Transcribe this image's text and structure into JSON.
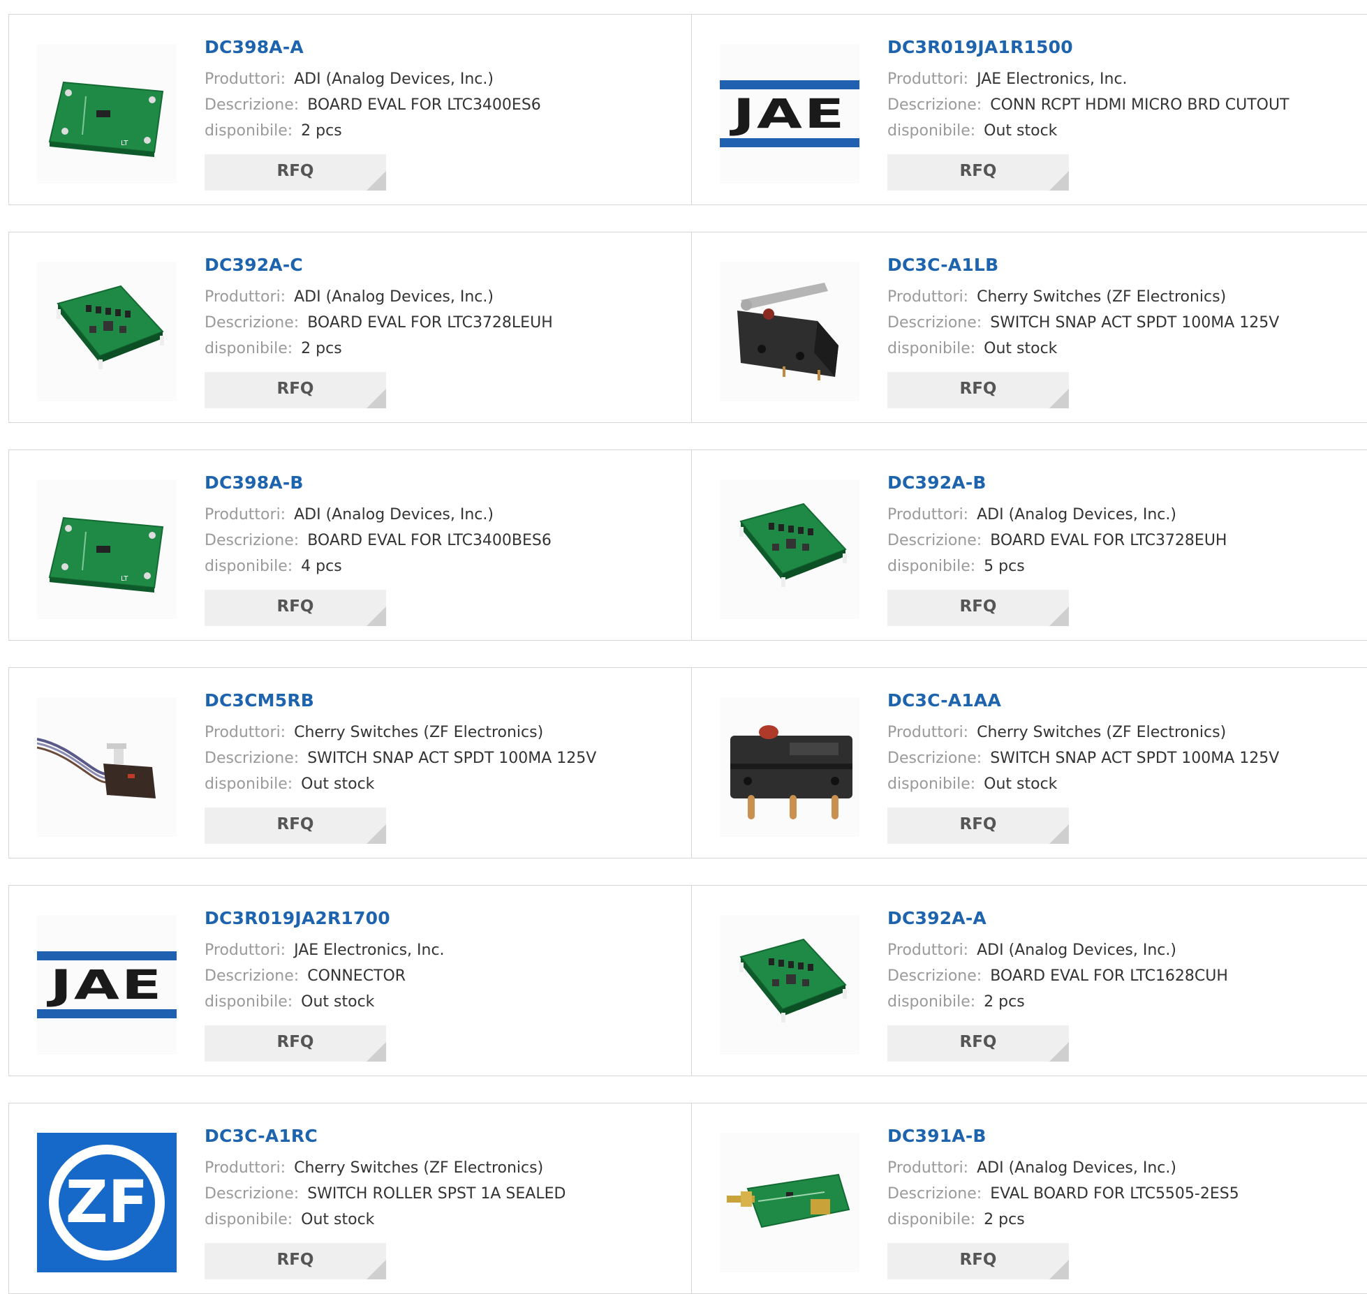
{
  "labels": {
    "manufacturer": "Produttori:",
    "description": "Descrizione:",
    "available": "disponibile:",
    "rfq": "RFQ"
  },
  "products": [
    {
      "pn": "DC398A-A",
      "manufacturer": "ADI (Analog Devices, Inc.)",
      "description": "BOARD EVAL FOR LTC3400ES6",
      "available": "2 pcs",
      "image": "pcb-small-icon"
    },
    {
      "pn": "DC3R019JA1R1500",
      "manufacturer": "JAE Electronics, Inc.",
      "description": "CONN RCPT HDMI MICRO BRD CUTOUT",
      "available": "Out stock",
      "image": "jae-logo",
      "logo_text": "JAE"
    },
    {
      "pn": "DC392A-C",
      "manufacturer": "ADI (Analog Devices, Inc.)",
      "description": "BOARD EVAL FOR LTC3728LEUH",
      "available": "2 pcs",
      "image": "pcb-square-icon"
    },
    {
      "pn": "DC3C-A1LB",
      "manufacturer": "Cherry Switches (ZF Electronics)",
      "description": "SWITCH SNAP ACT SPDT 100MA 125V",
      "available": "Out stock",
      "image": "lever-switch-icon"
    },
    {
      "pn": "DC398A-B",
      "manufacturer": "ADI (Analog Devices, Inc.)",
      "description": "BOARD EVAL FOR LTC3400BES6",
      "available": "4 pcs",
      "image": "pcb-small-icon"
    },
    {
      "pn": "DC392A-B",
      "manufacturer": "ADI (Analog Devices, Inc.)",
      "description": "BOARD EVAL FOR LTC3728EUH",
      "available": "5 pcs",
      "image": "pcb-square-icon"
    },
    {
      "pn": "DC3CM5RB",
      "manufacturer": "Cherry Switches (ZF Electronics)",
      "description": "SWITCH SNAP ACT SPDT 100MA 125V",
      "available": "Out stock",
      "image": "wired-switch-icon"
    },
    {
      "pn": "DC3C-A1AA",
      "manufacturer": "Cherry Switches (ZF Electronics)",
      "description": "SWITCH SNAP ACT SPDT 100MA 125V",
      "available": "Out stock",
      "image": "snap-switch-icon"
    },
    {
      "pn": "DC3R019JA2R1700",
      "manufacturer": "JAE Electronics, Inc.",
      "description": "CONNECTOR",
      "available": "Out stock",
      "image": "jae-logo",
      "logo_text": "JAE"
    },
    {
      "pn": "DC392A-A",
      "manufacturer": "ADI (Analog Devices, Inc.)",
      "description": "BOARD EVAL FOR LTC1628CUH",
      "available": "2 pcs",
      "image": "pcb-square-icon"
    },
    {
      "pn": "DC3C-A1RC",
      "manufacturer": "Cherry Switches (ZF Electronics)",
      "description": "SWITCH ROLLER SPST 1A SEALED",
      "available": "Out stock",
      "image": "zf-logo",
      "logo_text": "ZF"
    },
    {
      "pn": "DC391A-B",
      "manufacturer": "ADI (Analog Devices, Inc.)",
      "description": "EVAL BOARD FOR LTC5505-2ES5",
      "available": "2 pcs",
      "image": "rf-board-icon"
    }
  ],
  "colors": {
    "link": "#1e63ad",
    "label": "#9a9a9a",
    "border": "#d6d6d6",
    "button": "#efefef",
    "jae_blue": "#2060b0",
    "zf_blue": "#1769c9",
    "pcb_green": "#1f8a45"
  }
}
